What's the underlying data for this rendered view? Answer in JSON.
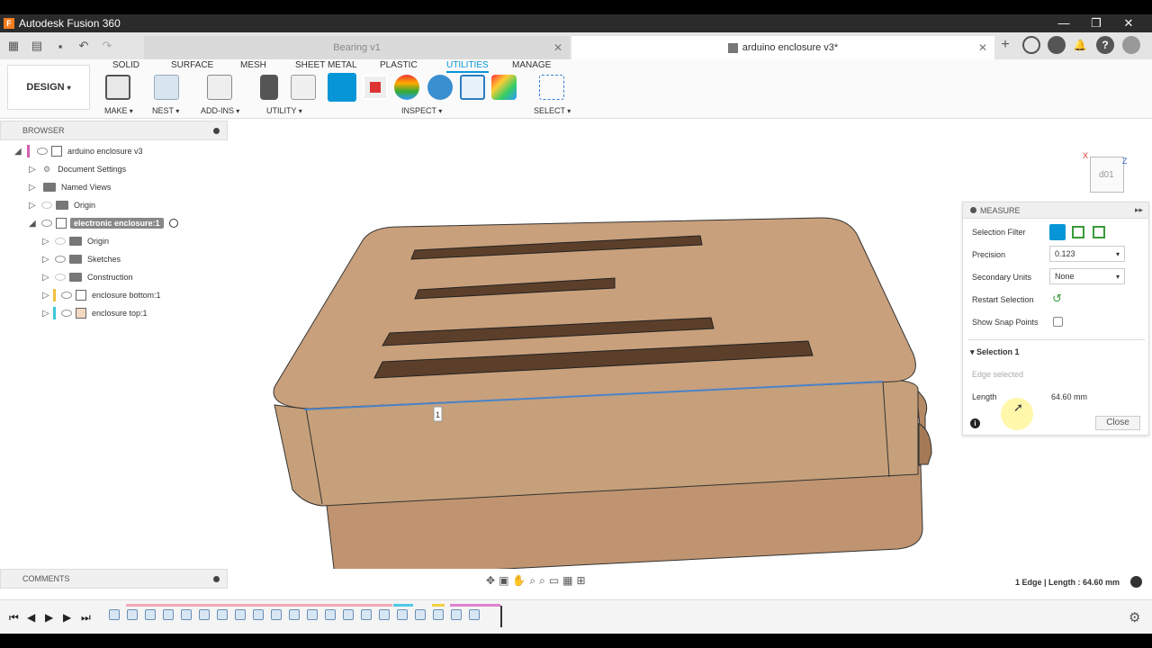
{
  "window": {
    "title": "Autodesk Fusion 360",
    "logo_letter": "F",
    "minimize": "—",
    "maximize": "❐",
    "close": "✕"
  },
  "tabs": [
    {
      "label": "Bearing v1",
      "active": false
    },
    {
      "label": "arduino enclosure v3*",
      "active": true
    }
  ],
  "toolbar": {
    "workspace": "DESIGN",
    "workspace_tabs": [
      "SOLID",
      "SURFACE",
      "MESH",
      "SHEET METAL",
      "PLASTIC",
      "UTILITIES",
      "MANAGE"
    ],
    "active_tab": "UTILITIES",
    "groups": [
      "MAKE",
      "NEST",
      "ADD-INS",
      "UTILITY",
      "INSPECT",
      "SELECT"
    ]
  },
  "browser": {
    "title": "BROWSER",
    "nodes": [
      {
        "label": "arduino enclosure v3",
        "icon": "component-icon"
      },
      {
        "label": "Document Settings",
        "icon": "gear-icon"
      },
      {
        "label": "Named Views",
        "icon": "folder-icon"
      },
      {
        "label": "Origin",
        "icon": "folder-icon"
      },
      {
        "label": "electronic enclosure:1",
        "icon": "component-icon"
      },
      {
        "label": "Origin",
        "icon": "folder-icon"
      },
      {
        "label": "Sketches",
        "icon": "folder-icon"
      },
      {
        "label": "Construction",
        "icon": "folder-icon"
      },
      {
        "label": "enclosure bottom:1",
        "icon": "body-icon"
      },
      {
        "label": "enclosure top:1",
        "icon": "body-icon"
      }
    ]
  },
  "viewcube": {
    "face_label": "d01",
    "x_axis": "X",
    "z_axis": "Z"
  },
  "viewport": {
    "edge_label": "1"
  },
  "measure": {
    "title": "MEASURE",
    "selection_filter_label": "Selection Filter",
    "precision_label": "Precision",
    "precision_value": "0.123",
    "secondary_units_label": "Secondary Units",
    "secondary_units_value": "None",
    "restart_label": "Restart Selection",
    "snap_label": "Show Snap Points",
    "selection_heading": "Selection 1",
    "selection_desc": "Edge selected",
    "length_label": "Length",
    "length_value": "64.60 mm",
    "close_label": "Close"
  },
  "comments": {
    "title": "COMMENTS"
  },
  "status": {
    "text": "1 Edge | Length : 64.60 mm"
  },
  "colors": {
    "accent": "#0696d7",
    "body": "#c9a07c",
    "body_shadow": "#b48a66"
  }
}
